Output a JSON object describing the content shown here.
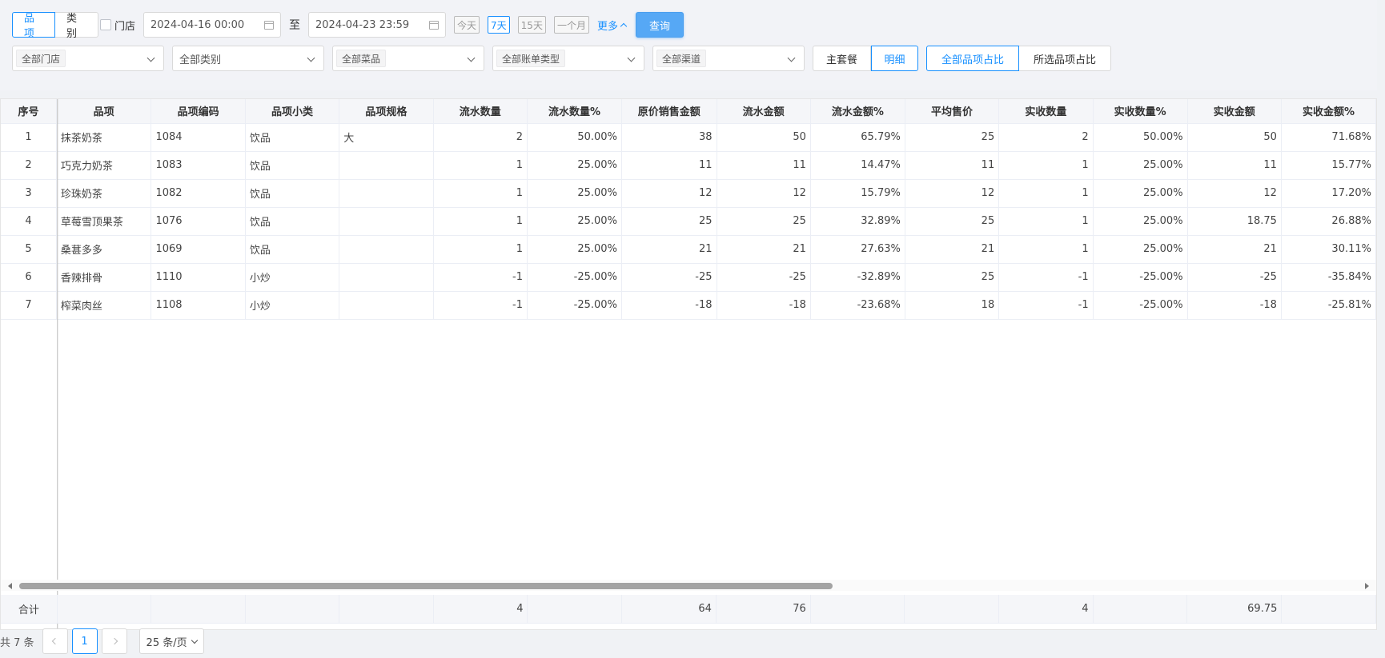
{
  "mode_tabs": [
    "品项",
    "类别"
  ],
  "store_checkbox_label": "门店",
  "date_start": "2024-04-16 00:00",
  "date_to": "至",
  "date_end": "2024-04-23 23:59",
  "quick_ranges": [
    "今天",
    "7天",
    "15天",
    "一个月"
  ],
  "more_label": "更多",
  "query_label": "查询",
  "selects": {
    "store": "全部门店",
    "category": "全部类别",
    "dish": "全部菜品",
    "bill_type": "全部账单类型",
    "channel": "全部渠道"
  },
  "combo_tabs": [
    "主套餐",
    "明细"
  ],
  "ratio_tabs": [
    "全部品项占比",
    "所选品项占比"
  ],
  "columns": [
    "序号",
    "品项",
    "品项编码",
    "品项小类",
    "品项规格",
    "流水数量",
    "流水数量%",
    "原价销售金额",
    "流水金额",
    "流水金额%",
    "平均售价",
    "实收数量",
    "实收数量%",
    "实收金额",
    "实收金额%"
  ],
  "rows": [
    [
      "1",
      "抹茶奶茶",
      "1084",
      "饮品",
      "大",
      "2",
      "50.00%",
      "38",
      "50",
      "65.79%",
      "25",
      "2",
      "50.00%",
      "50",
      "71.68%"
    ],
    [
      "2",
      "巧克力奶茶",
      "1083",
      "饮品",
      "",
      "1",
      "25.00%",
      "11",
      "11",
      "14.47%",
      "11",
      "1",
      "25.00%",
      "11",
      "15.77%"
    ],
    [
      "3",
      "珍珠奶茶",
      "1082",
      "饮品",
      "",
      "1",
      "25.00%",
      "12",
      "12",
      "15.79%",
      "12",
      "1",
      "25.00%",
      "12",
      "17.20%"
    ],
    [
      "4",
      "草莓雪顶果茶",
      "1076",
      "饮品",
      "",
      "1",
      "25.00%",
      "25",
      "25",
      "32.89%",
      "25",
      "1",
      "25.00%",
      "18.75",
      "26.88%"
    ],
    [
      "5",
      "桑葚多多",
      "1069",
      "饮品",
      "",
      "1",
      "25.00%",
      "21",
      "21",
      "27.63%",
      "21",
      "1",
      "25.00%",
      "21",
      "30.11%"
    ],
    [
      "6",
      "香辣排骨",
      "1110",
      "小炒",
      "",
      "-1",
      "-25.00%",
      "-25",
      "-25",
      "-32.89%",
      "25",
      "-1",
      "-25.00%",
      "-25",
      "-35.84%"
    ],
    [
      "7",
      "榨菜肉丝",
      "1108",
      "小炒",
      "",
      "-1",
      "-25.00%",
      "-18",
      "-18",
      "-23.68%",
      "18",
      "-1",
      "-25.00%",
      "-18",
      "-25.81%"
    ]
  ],
  "summary": [
    "合计",
    "",
    "",
    "",
    "",
    "4",
    "",
    "64",
    "76",
    "",
    "",
    "4",
    "",
    "69.75",
    ""
  ],
  "pager": {
    "total": "共 7 条",
    "current": "1",
    "page_size": "25 条/页"
  }
}
